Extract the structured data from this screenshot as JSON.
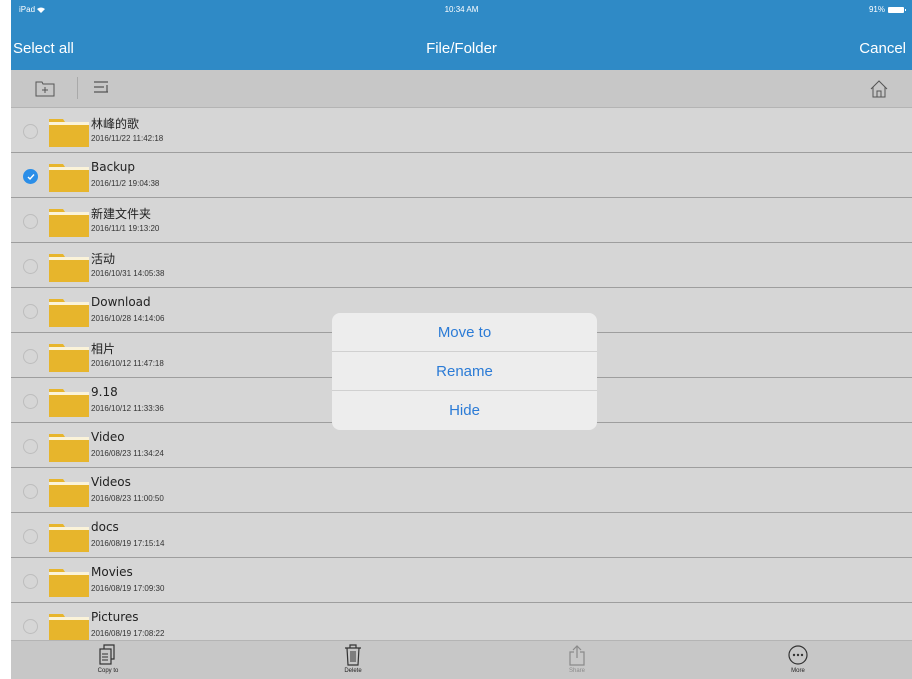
{
  "status_bar": {
    "carrier": "iPad",
    "time": "10:34 AM",
    "battery": "91%"
  },
  "nav": {
    "select_all": "Select all",
    "title": "File/Folder",
    "cancel": "Cancel"
  },
  "toolbar": {
    "icons": [
      "new-folder-icon",
      "sort-icon",
      "home-icon"
    ]
  },
  "files": [
    {
      "name": "林峰的歌",
      "date": "2016/11/22 11:42:18",
      "selected": false
    },
    {
      "name": "Backup",
      "date": "2016/11/2 19:04:38",
      "selected": true
    },
    {
      "name": "新建文件夹",
      "date": "2016/11/1 19:13:20",
      "selected": false
    },
    {
      "name": "活动",
      "date": "2016/10/31 14:05:38",
      "selected": false
    },
    {
      "name": "Download",
      "date": "2016/10/28 14:14:06",
      "selected": false
    },
    {
      "name": "相片",
      "date": "2016/10/12 11:47:18",
      "selected": false
    },
    {
      "name": "9.18",
      "date": "2016/10/12 11:33:36",
      "selected": false
    },
    {
      "name": "Video",
      "date": "2016/08/23 11:34:24",
      "selected": false
    },
    {
      "name": "Videos",
      "date": "2016/08/23 11:00:50",
      "selected": false
    },
    {
      "name": "docs",
      "date": "2016/08/19 17:15:14",
      "selected": false
    },
    {
      "name": "Movies",
      "date": "2016/08/19 17:09:30",
      "selected": false
    },
    {
      "name": "Pictures",
      "date": "2016/08/19 17:08:22",
      "selected": false
    }
  ],
  "popup": {
    "move_to": "Move to",
    "rename": "Rename",
    "hide": "Hide"
  },
  "tabbar": {
    "copy_to": "Copy to",
    "delete": "Delete",
    "share": "Share",
    "more": "More"
  },
  "colors": {
    "accent": "#2f8ac6",
    "folder": "#e7b52c",
    "link": "#2b7bd6",
    "check": "#2b8ee8"
  }
}
